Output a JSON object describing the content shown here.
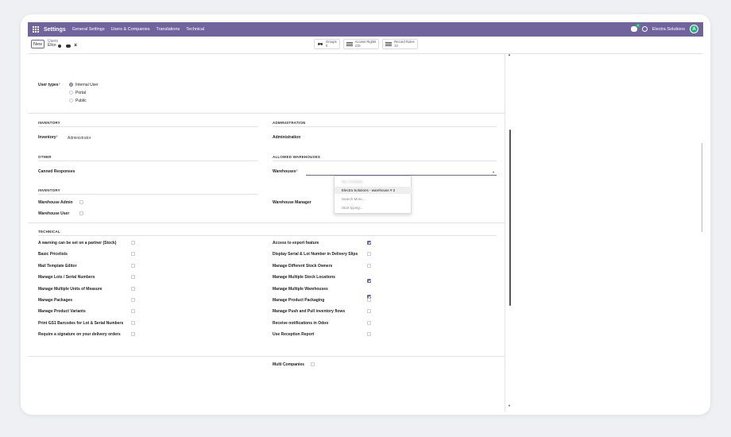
{
  "nav": {
    "app_title": "Settings",
    "menu": [
      "General Settings",
      "Users & Companies",
      "Translations",
      "Technical"
    ],
    "chat_badge": "4",
    "company": "Electra Solutions",
    "avatar_letter": "A"
  },
  "control": {
    "new_label": "New",
    "breadcrumb_parent": "Users",
    "record_name": "Elice",
    "smart_buttons": [
      {
        "label": "Groups",
        "count": "9",
        "icon": "users-icon"
      },
      {
        "label": "Access Rights",
        "count": "235",
        "icon": "list-icon"
      },
      {
        "label": "Record Rules",
        "count": "32",
        "icon": "list-icon"
      }
    ]
  },
  "user_types": {
    "label": "User types",
    "sup": "?",
    "options": [
      {
        "label": "Internal User",
        "selected": true
      },
      {
        "label": "Portal",
        "selected": false
      },
      {
        "label": "Public",
        "selected": false
      }
    ]
  },
  "inventory_section": {
    "title": "INVENTORY",
    "field_label": "Inventory",
    "sup": "?",
    "field_value": "Administrator"
  },
  "administration_section": {
    "title": "ADMINISTRATION",
    "field_label": "Administration"
  },
  "other_section": {
    "title": "OTHER",
    "field_label": "Canned Responses"
  },
  "allowed_warehouses": {
    "title": "ALLOWED WAREHOUSES",
    "field_label": "Warehouses",
    "sup": "?"
  },
  "dropdown": {
    "items": [
      {
        "label": "My Company",
        "style": "blur"
      },
      {
        "label": "Electra Solutions - warehouse # 2",
        "style": "active"
      },
      {
        "label": "Search More...",
        "style": "muted"
      },
      {
        "label": "Start typing...",
        "style": "italic"
      }
    ]
  },
  "inventory2_section": {
    "title": "INVENTORY",
    "left": [
      {
        "label": "Warehouse Admin",
        "checked": false
      },
      {
        "label": "Warehouse User",
        "checked": false
      }
    ],
    "right_label": "Warehouse Manager"
  },
  "technical_section": {
    "title": "TECHNICAL",
    "left": [
      {
        "label": "A warning can be set on a partner (Stock)",
        "checked": false
      },
      {
        "label": "Basic Pricelists",
        "checked": false
      },
      {
        "label": "Mail Template Editor",
        "checked": false
      },
      {
        "label": "Manage Lots / Serial Numbers",
        "checked": false
      },
      {
        "label": "Manage Multiple Units of Measure",
        "checked": false
      },
      {
        "label": "Manage Packages",
        "checked": false
      },
      {
        "label": "Manage Product Variants",
        "checked": false
      },
      {
        "label": "Print GS1 Barcodes for Lot & Serial Numbers",
        "checked": false
      },
      {
        "label": "Require a signature on your delivery orders",
        "checked": false
      }
    ],
    "right": [
      {
        "label": "Access to export feature",
        "checked": true
      },
      {
        "label": "Display Serial & Lot Number in Delivery Slips",
        "checked": false
      },
      {
        "label": "Manage Different Stock Owners",
        "checked": false
      },
      {
        "label": "Manage Multiple Stock Locations",
        "checked": true
      },
      {
        "label": "Manage Multiple Warehouses",
        "checked": true
      },
      {
        "label": "Manage Product Packaging",
        "checked": false
      },
      {
        "label": "Manage Push and Pull inventory flows",
        "checked": false
      },
      {
        "label": "Receive notifications in Odoo",
        "checked": false
      },
      {
        "label": "Use Reception Report",
        "checked": false
      }
    ]
  },
  "multi_companies": {
    "label": "Multi Companies",
    "checked": false
  },
  "colors": {
    "brand": "#71639e",
    "accent_green": "#1fb27a"
  }
}
